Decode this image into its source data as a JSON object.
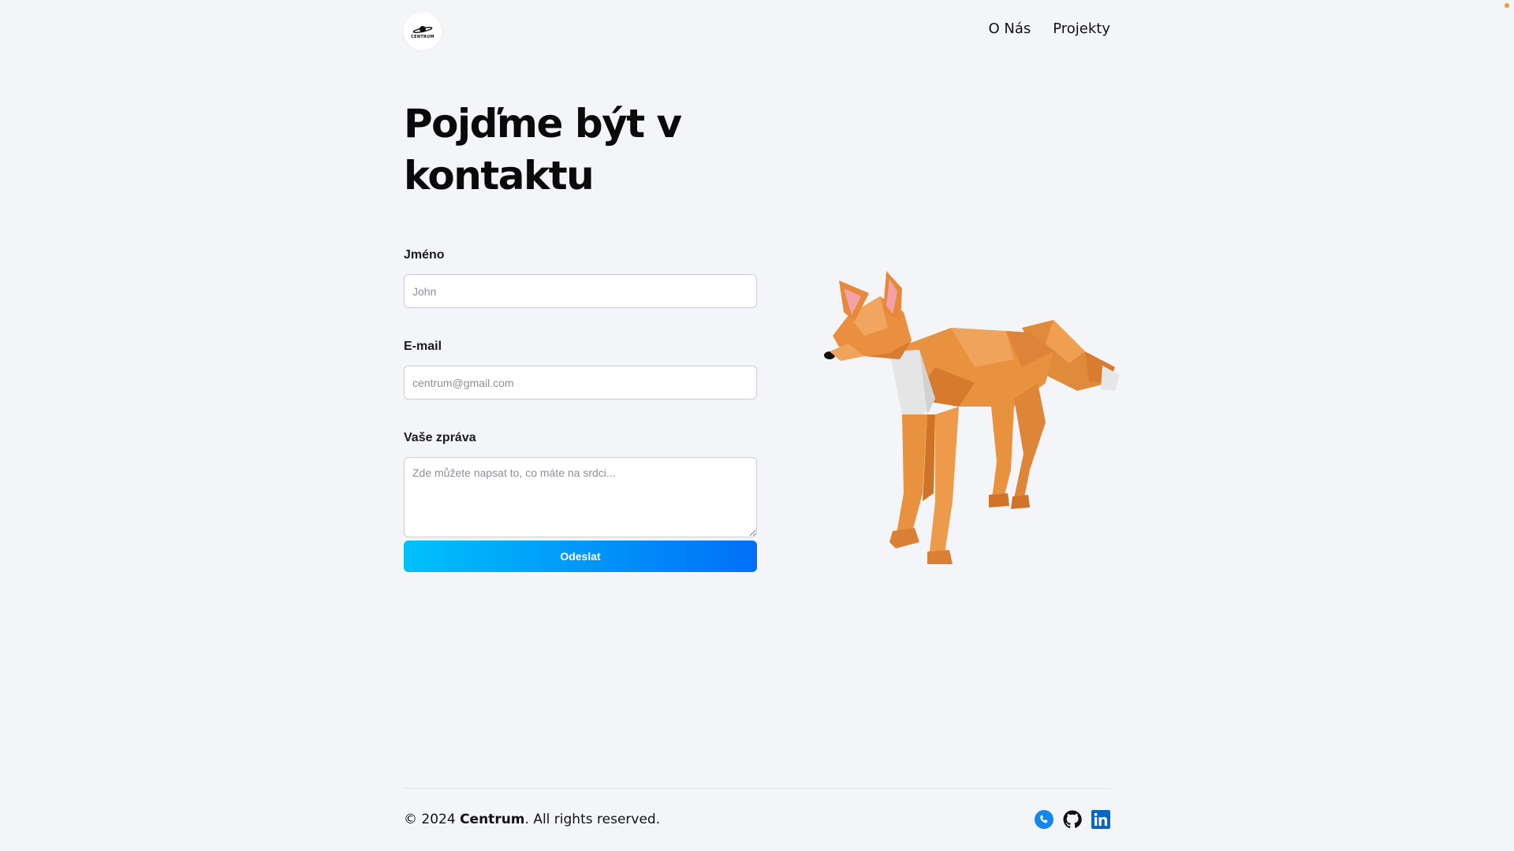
{
  "header": {
    "logo_text": "CENTRUM",
    "nav": [
      {
        "label": "O Nás"
      },
      {
        "label": "Projekty"
      }
    ]
  },
  "hero": {
    "title": "Pojďme být v kontaktu"
  },
  "form": {
    "name": {
      "label": "Jméno",
      "placeholder": "John"
    },
    "email": {
      "label": "E-mail",
      "placeholder": "centrum@gmail.com"
    },
    "message": {
      "label": "Vaše zpráva",
      "placeholder": "Zde můžete napsat to, co máte na srdci..."
    },
    "submit_label": "Odeslat"
  },
  "footer": {
    "copyright_prefix": "© 2024 ",
    "brand": "Centrum",
    "copyright_suffix": ". All rights reserved.",
    "socials": [
      {
        "icon": "phone-icon",
        "color": "#1487e8"
      },
      {
        "icon": "github-icon",
        "color": "#111111"
      },
      {
        "icon": "linkedin-icon",
        "color": "#0a66c2"
      }
    ]
  },
  "colors": {
    "background": "#f4f5f8",
    "button_gradient_start": "#00c0fb",
    "button_gradient_end": "#0070f7",
    "fox_orange": "#e88a3a"
  }
}
